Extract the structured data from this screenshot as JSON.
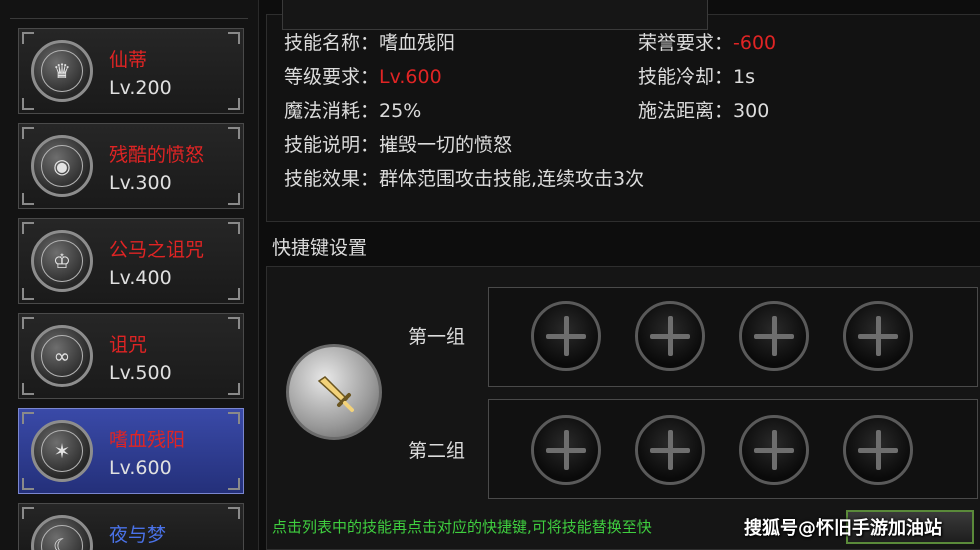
{
  "skills": [
    {
      "name": "仙蒂",
      "level": "Lv.200",
      "icon": "helmet-icon",
      "name_color": "#e02424"
    },
    {
      "name": "残酷的愤怒",
      "level": "Lv.300",
      "icon": "eye-icon",
      "name_color": "#e02424"
    },
    {
      "name": "公马之诅咒",
      "level": "Lv.400",
      "icon": "crown-icon",
      "name_color": "#e02424"
    },
    {
      "name": "诅咒",
      "level": "Lv.500",
      "icon": "swirl-icon",
      "name_color": "#e02424"
    },
    {
      "name": "嗜血残阳",
      "level": "Lv.600",
      "icon": "claw-icon",
      "name_color": "#e02424",
      "selected": true
    },
    {
      "name": "夜与梦",
      "level": "",
      "icon": "moon-icon",
      "name_color": "#4a72e8"
    }
  ],
  "info": {
    "name_label": "技能名称：",
    "name_value": "嗜血残阳",
    "honor_label": "荣誉要求：",
    "honor_value": "-600",
    "level_label": "等级要求：",
    "level_value": "Lv.600",
    "cooldown_label": "技能冷却：",
    "cooldown_value": "1s",
    "mana_label": "魔法消耗：",
    "mana_value": "25%",
    "range_label": "施法距离：",
    "range_value": "300",
    "desc_label": "技能说明：",
    "desc_value": "摧毁一切的愤怒",
    "effect_label": "技能效果：",
    "effect_value": "群体范围攻击技能,连续攻击3次"
  },
  "hotkey": {
    "title": "快捷键设置",
    "group1_label": "第一组",
    "group2_label": "第二组",
    "hint": "点击列表中的技能再点击对应的快捷键,可将技能替换至快"
  },
  "watermark": "搜狐号@怀旧手游加油站",
  "colors": {
    "accent_red": "#e02424",
    "hint_green": "#3fce3f",
    "selected_blue": "#3a4aa8"
  }
}
